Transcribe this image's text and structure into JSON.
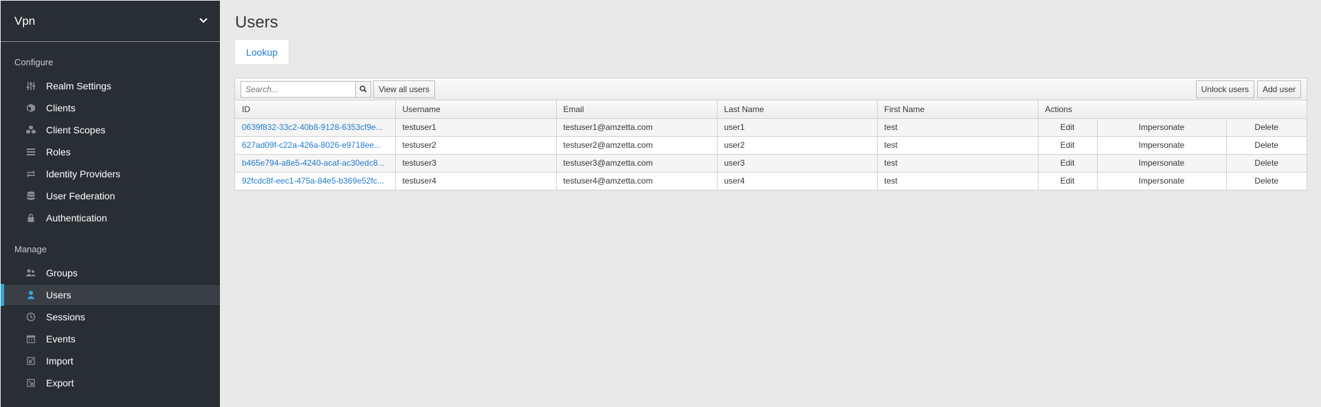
{
  "sidebar": {
    "realm": "Vpn",
    "configure_label": "Configure",
    "manage_label": "Manage",
    "configure_items": [
      {
        "label": "Realm Settings",
        "icon": "sliders-icon"
      },
      {
        "label": "Clients",
        "icon": "cube-icon"
      },
      {
        "label": "Client Scopes",
        "icon": "cubes-icon"
      },
      {
        "label": "Roles",
        "icon": "list-icon"
      },
      {
        "label": "Identity Providers",
        "icon": "exchange-icon"
      },
      {
        "label": "User Federation",
        "icon": "database-icon"
      },
      {
        "label": "Authentication",
        "icon": "lock-icon"
      }
    ],
    "manage_items": [
      {
        "label": "Groups",
        "icon": "users-icon"
      },
      {
        "label": "Users",
        "icon": "user-icon",
        "active": true
      },
      {
        "label": "Sessions",
        "icon": "clock-icon"
      },
      {
        "label": "Events",
        "icon": "calendar-icon"
      },
      {
        "label": "Import",
        "icon": "import-icon"
      },
      {
        "label": "Export",
        "icon": "export-icon"
      }
    ]
  },
  "main": {
    "title": "Users",
    "tab": "Lookup",
    "search_placeholder": "Search...",
    "view_all_label": "View all users",
    "unlock_label": "Unlock users",
    "add_user_label": "Add user",
    "columns": [
      "ID",
      "Username",
      "Email",
      "Last Name",
      "First Name",
      "Actions"
    ],
    "actions": [
      "Edit",
      "Impersonate",
      "Delete"
    ],
    "rows": [
      {
        "id": "0639f832-33c2-40b8-9128-6353cf9e...",
        "username": "testuser1",
        "email": "testuser1@amzetta.com",
        "last": "user1",
        "first": "test"
      },
      {
        "id": "627ad09f-c22a-426a-8026-e9718ee...",
        "username": "testuser2",
        "email": "testuser2@amzetta.com",
        "last": "user2",
        "first": "test"
      },
      {
        "id": "b465e794-a8e5-4240-acaf-ac30edc8...",
        "username": "testuser3",
        "email": "testuser3@amzetta.com",
        "last": "user3",
        "first": "test"
      },
      {
        "id": "92fcdc8f-eec1-475a-84e5-b369e52fc...",
        "username": "testuser4",
        "email": "testuser4@amzetta.com",
        "last": "user4",
        "first": "test"
      }
    ]
  },
  "colors": {
    "sidebar_bg": "#292e34",
    "active_accent": "#39a5dc",
    "link": "#1f7bd0"
  }
}
